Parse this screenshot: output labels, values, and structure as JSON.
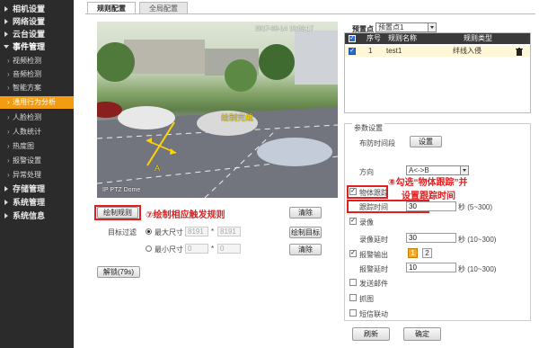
{
  "sidebar": {
    "items": [
      {
        "label": "相机设置",
        "type": "top"
      },
      {
        "label": "网络设置",
        "type": "top"
      },
      {
        "label": "云台设置",
        "type": "top"
      },
      {
        "label": "事件管理",
        "type": "top-open"
      },
      {
        "label": "视频检测",
        "type": "sub"
      },
      {
        "label": "音频检测",
        "type": "sub"
      },
      {
        "label": "智能方案",
        "type": "sub"
      },
      {
        "label": "通用行为分析",
        "type": "sub-active"
      },
      {
        "label": "人脸检测",
        "type": "sub"
      },
      {
        "label": "人数统计",
        "type": "sub"
      },
      {
        "label": "热度图",
        "type": "sub"
      },
      {
        "label": "报警设置",
        "type": "sub"
      },
      {
        "label": "异常处理",
        "type": "sub"
      },
      {
        "label": "存储管理",
        "type": "top"
      },
      {
        "label": "系统管理",
        "type": "top"
      },
      {
        "label": "系统信息",
        "type": "top"
      }
    ]
  },
  "tabs": [
    "规则配置",
    "全局配置"
  ],
  "video": {
    "timestamp": "2017-03-14 13:53:17",
    "overlay_label": "绘制完成",
    "line_label": "A",
    "camera_name": "IP PTZ Dome"
  },
  "left_controls": {
    "draw_rule": "绘制规则",
    "clear": "清除",
    "draw_target": "绘制目标",
    "clear2": "清除",
    "target_filter_label": "目标过滤",
    "max_size_label": "最大尺寸",
    "min_size_label": "最小尺寸",
    "max_w": "8191",
    "max_h": "8191",
    "min_w": "0",
    "min_h": "0",
    "size_sep": "*",
    "unlock": "解锁(79s)"
  },
  "annotations": {
    "step7": "⑦绘制相应触发规则",
    "step8_line1": "⑧勾选“物体跟踪”并",
    "step8_line2": "设置跟踪时间"
  },
  "preset": {
    "label": "预置点",
    "value": "预置点1"
  },
  "rule_table": {
    "headers": [
      "序号",
      "规则名称",
      "规则类型"
    ],
    "rows": [
      {
        "index": "1",
        "name": "test1",
        "type": "绊线入侵",
        "checked": true
      }
    ]
  },
  "params": {
    "section_title": "参数设置",
    "schedule_label": "布防时间段",
    "schedule_button": "设置",
    "direction_label": "方向",
    "direction_value": "A<->B",
    "object_tracking_label": "物体跟踪",
    "tracking_time_label": "跟踪时间",
    "tracking_time_value": "30",
    "tracking_time_unit": "秒 (5~300)",
    "record_label": "录像",
    "record_delay_label": "录像延时",
    "record_delay_value": "30",
    "record_delay_unit": "秒 (10~300)",
    "alarm_out_label": "报警输出",
    "alarm_out_1": "1",
    "alarm_out_2": "2",
    "alarm_delay_label": "报警延时",
    "alarm_delay_value": "10",
    "alarm_delay_unit": "秒 (10~300)",
    "send_email_label": "发送邮件",
    "snapshot_label": "抓图",
    "ptz_link_label": "短信联动"
  },
  "footer": {
    "refresh": "刷新",
    "confirm": "确定"
  },
  "colors": {
    "accent": "#f39c12",
    "annotation": "#e02020",
    "sidebar_bg": "#2b2b2b"
  }
}
